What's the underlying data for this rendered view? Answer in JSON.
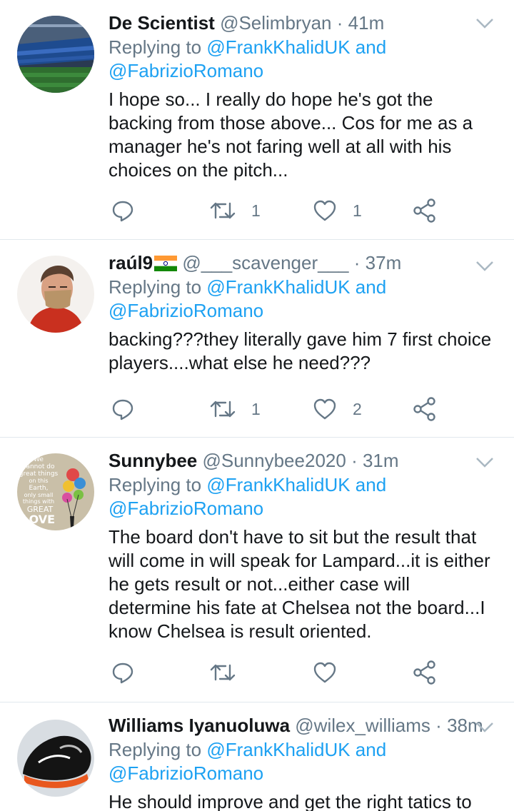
{
  "tweets": [
    {
      "name": "De Scientist",
      "handle": "@Selimbryan",
      "time": "41m",
      "reply_prefix": "Replying to",
      "reply_to_1": "@FrankKhalidUK",
      "reply_and": "and",
      "reply_to_2": "@FabrizioRomano",
      "text": "I hope so... I really do hope he's got the backing from those above... Cos for me as a manager he's not faring well at all with his choices on the pitch...",
      "retweets": "1",
      "likes": "1",
      "avatar_icon": "stadium-avatar-icon"
    },
    {
      "name": "raúl9",
      "handle": "@___scavenger___",
      "time": "37m",
      "reply_prefix": "Replying to",
      "reply_to_1": "@FrankKhalidUK",
      "reply_and": "and",
      "reply_to_2": "@FabrizioRomano",
      "text": "backing???they literally gave him 7 first choice players....what else he need???",
      "retweets": "1",
      "likes": "2",
      "avatar_icon": "person-mask-avatar-icon",
      "flag_icon": "india-flag-icon"
    },
    {
      "name": "Sunnybee",
      "handle": "@Sunnybee2020",
      "time": "31m",
      "reply_prefix": "Replying to",
      "reply_to_1": "@FrankKhalidUK",
      "reply_and": "and",
      "reply_to_2": "@FabrizioRomano",
      "text": "The board don't have to sit but the result that will come in will speak for Lampard...it is either he gets result or not...either case will determine his fate at Chelsea not the board...I know Chelsea is result oriented.",
      "retweets": "",
      "likes": "",
      "avatar_icon": "quote-poster-avatar-icon",
      "avatar_text": [
        "We",
        "cannot do",
        "great things",
        "on this",
        "Earth,",
        "only small",
        "things with",
        "GREAT",
        "LOVE"
      ]
    },
    {
      "name": "Williams Iyanuoluwa",
      "handle": "@wilex_williams",
      "time": "38m",
      "reply_prefix": "Replying to",
      "reply_to_1": "@FrankKhalidUK",
      "reply_and": "and",
      "reply_to_2": "@FabrizioRomano",
      "text": "He should improve and get the right tatics to",
      "avatar_icon": "sneaker-avatar-icon"
    }
  ],
  "separator": "·",
  "icons": {
    "reply": "reply-icon",
    "retweet": "retweet-icon",
    "like": "heart-icon",
    "share": "share-icon",
    "menu": "chevron-down-icon"
  },
  "colors": {
    "link": "#1da1f2",
    "secondary_text": "#657786",
    "primary_text": "#14171a",
    "divider": "#e1e8ed"
  }
}
